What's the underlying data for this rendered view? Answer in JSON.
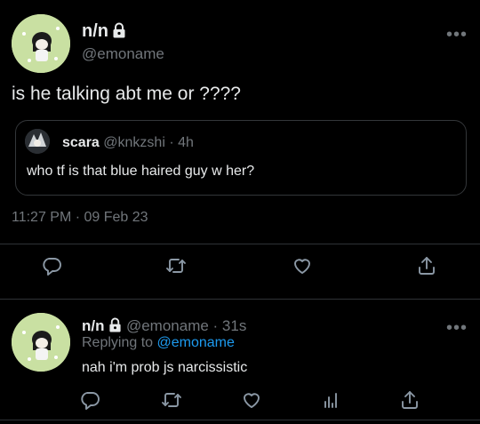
{
  "tweet": {
    "author_name": "n/n",
    "author_handle": "@emoname",
    "text": "is he talking abt me or ????",
    "timestamp": "11:27 PM · 09 Feb 23",
    "more_label": "•••"
  },
  "quote": {
    "author_name": "scara",
    "author_meta": "@knkzshi · 4h",
    "text": "who tf is that blue haired guy w her?"
  },
  "reply": {
    "author_name": "n/n",
    "author_meta": "@emoname · 31s",
    "replying_prefix": "Replying to",
    "replying_handle": "@emoname",
    "text": "nah i'm prob js narcissistic",
    "more_label": "•••"
  },
  "icons": [
    "lock-icon",
    "reply-icon",
    "retweet-icon",
    "like-icon",
    "share-icon",
    "analytics-icon",
    "more-icon"
  ],
  "colors": {
    "background": "#000000",
    "text": "#e7e9ea",
    "muted": "#71767b",
    "link": "#1d9bf0",
    "divider": "#2f3336"
  }
}
